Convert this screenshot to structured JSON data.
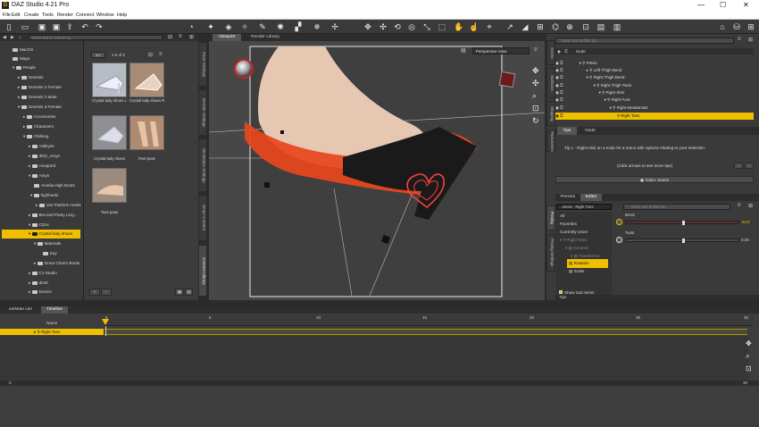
{
  "app": {
    "title": "DAZ Studio 4.21 Pro",
    "logo": "daz-logo-icon"
  },
  "menu": [
    "File",
    "Edit",
    "Create",
    "Tools",
    "Render",
    "Connect",
    "Window",
    "Help"
  ],
  "left": {
    "search_placeholder": "Enter text to search by...",
    "tree": [
      "MacOS",
      "Maps",
      "People",
      "Genesis",
      "Genesis 2 Female",
      "Genesis 2 Male",
      "Genesis 3 Female",
      "Accessories",
      "Characters",
      "Clothing",
      "!Valkyrie",
      "3DD_Amyn",
      "Amapord",
      "Amyn",
      "Amelia High Boots",
      "highheels",
      "10e Platform Heels",
      "Bra and Panty Ling...",
      "CDxx",
      "Crystal lady shoes",
      "Materials",
      "tray",
      "Great Charm Boots",
      "CJ-Studio",
      "de30",
      "Exnem"
    ],
    "paging": "1-6 of 6",
    "thumbs": [
      "Crystal lady shoes L",
      "Crystal lady shoes R",
      "Crystal lady shoes",
      "Feet pose",
      "Toes pose"
    ],
    "vtabs": [
      "Pane Settings",
      "Render Settings",
      "Simulation Settings",
      "Smart Content",
      "Content Library"
    ]
  },
  "viewport": {
    "tabs": [
      "Viewport",
      "Render Library"
    ],
    "camera": "Perspective View"
  },
  "scene": {
    "search_placeholder": "Enter text to filter by...",
    "header": "Node",
    "nodes": [
      "Pelvis",
      "Left Thigh Bend",
      "Right Thigh Bend",
      "Right Thigh Twist",
      "Right Shin",
      "Right Foot",
      "Right Metatarsals",
      "Right Toes"
    ],
    "tips_tabs": [
      "Tips",
      "Node"
    ],
    "tip": "Tip 1 - Right-click on a node for a menu with options relating to your selection.",
    "tip_hint": "(Click arrows to see more tips)",
    "video": "Video: Scene",
    "param_tabs": [
      "Presets",
      "Editor"
    ],
    "dropdown": "...mesis : Right Toes",
    "filter_placeholder": "Enter text to filter by...",
    "param_tree": [
      "All",
      "Favorites",
      "Currently Used",
      "Right Toes",
      "General",
      "Transforms",
      "Rotation",
      "Scale"
    ],
    "show_sub": "Show Sub Items",
    "params": [
      {
        "name": "Bend",
        "value": "-8.67",
        "level": 0.5
      },
      {
        "name": "Twist",
        "value": "0.00",
        "level": 0.5
      }
    ],
    "vtabs": [
      "Scene",
      "Surfaces",
      "Shaping",
      "Parameters",
      "Posing",
      "Posing Settings",
      "Tips"
    ]
  },
  "timeline": {
    "tabs": [
      "aniMate Lite",
      "Timeline"
    ],
    "col_name": "Name",
    "track": "Right Toes",
    "ticks": [
      "0",
      "5",
      "10",
      "15",
      "20",
      "25",
      "30"
    ],
    "frame": "0",
    "end": "30"
  }
}
